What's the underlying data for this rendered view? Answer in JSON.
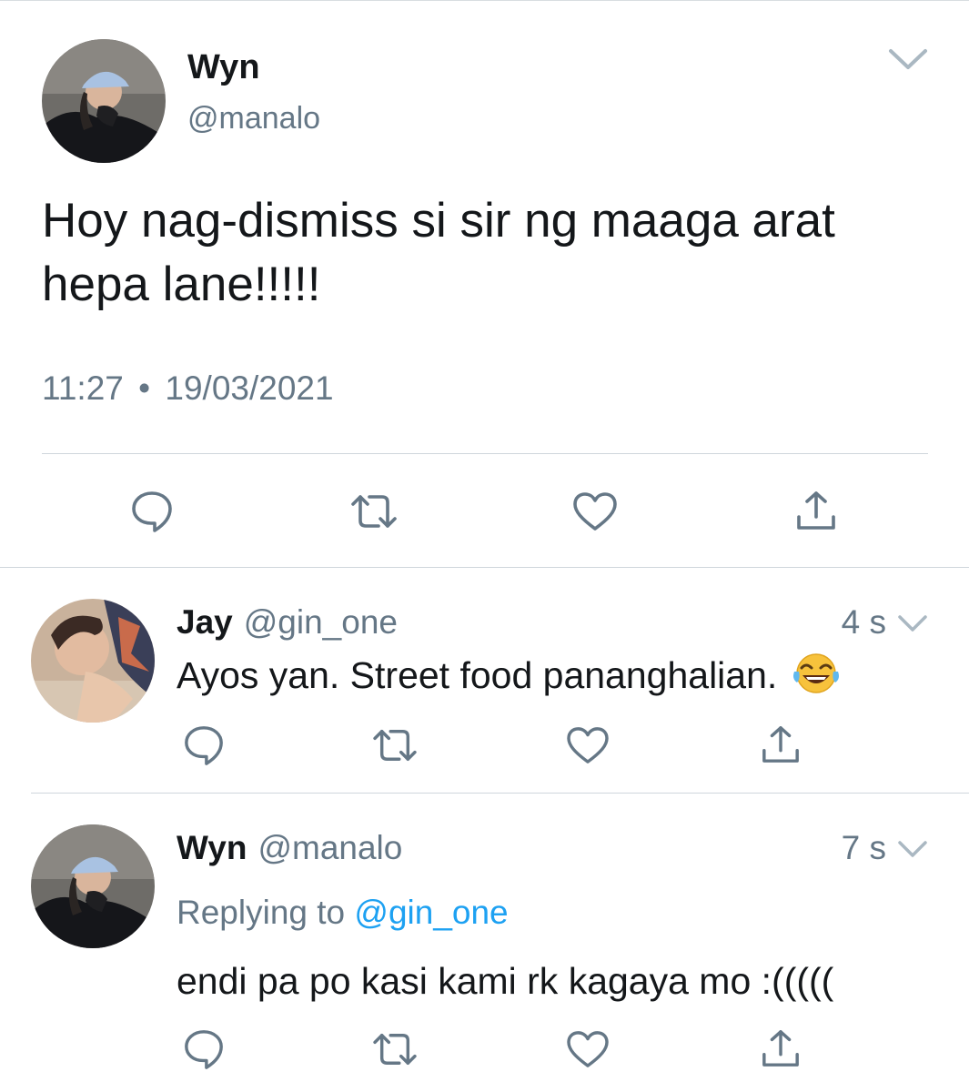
{
  "main_tweet": {
    "name": "Wyn",
    "handle": "@manalo",
    "text": "Hoy nag-dismiss si sir ng maaga arat hepa lane!!!!!",
    "time": "11:27",
    "separator": "•",
    "date": "19/03/2021",
    "actions": {
      "reply_icon": "reply-icon",
      "retweet_icon": "retweet-icon",
      "like_icon": "heart-icon",
      "share_icon": "share-icon"
    }
  },
  "replies": [
    {
      "name": "Jay",
      "handle": "@gin_one",
      "time": "4 s",
      "text": "Ayos yan. Street food pananghalian.",
      "emoji": "😂"
    },
    {
      "name": "Wyn",
      "handle": "@manalo",
      "time": "7 s",
      "replying_prefix": "Replying to",
      "replying_mention": "@gin_one",
      "text": "endi pa po kasi kami rk kagaya mo :((((("
    }
  ],
  "colors": {
    "text": "#14171a",
    "secondary": "#657786",
    "link": "#1da1f2",
    "divider": "#cfd6dc"
  }
}
